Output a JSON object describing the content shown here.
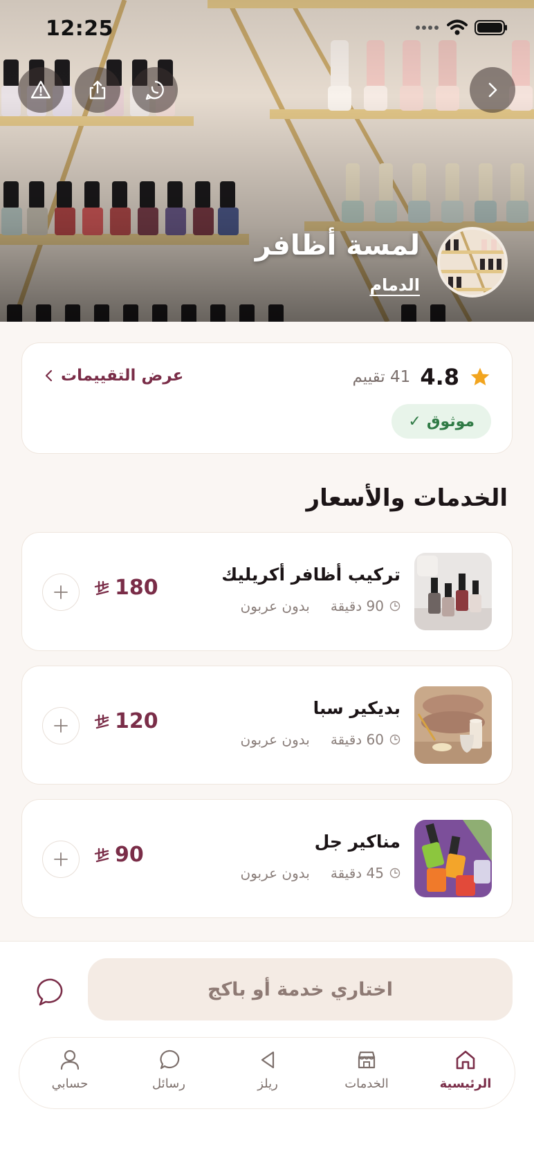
{
  "status_bar": {
    "time": "12:25"
  },
  "store": {
    "name": "لمسة أظافر",
    "city": "الدمام"
  },
  "rating": {
    "value": "4.8",
    "count_text": "41 تقييم",
    "view_reviews_label": "عرض التقييمات",
    "verified_label": "موثوق",
    "verified_check": "✓"
  },
  "services_section": {
    "title": "الخدمات والأسعار",
    "items": [
      {
        "name": "تركيب أظافر أكريليك",
        "duration": "90 دقيقة",
        "deposit": "بدون عربون",
        "price": "180"
      },
      {
        "name": "بديكير سبا",
        "duration": "60 دقيقة",
        "deposit": "بدون عربون",
        "price": "120"
      },
      {
        "name": "مناكير جل",
        "duration": "45 دقيقة",
        "deposit": "بدون عربون",
        "price": "90"
      }
    ]
  },
  "cta": {
    "label": "اختاري خدمة أو باكج"
  },
  "tabs": [
    {
      "label": "الرئيسية",
      "icon": "home-icon",
      "active": true
    },
    {
      "label": "الخدمات",
      "icon": "store-icon",
      "active": false
    },
    {
      "label": "ريلز",
      "icon": "play-icon",
      "active": false
    },
    {
      "label": "رسائل",
      "icon": "chat-icon",
      "active": false
    },
    {
      "label": "حسابي",
      "icon": "user-icon",
      "active": false
    }
  ],
  "colors": {
    "accent": "#7a2d48",
    "star": "#f2a51f",
    "verified_text": "#2f7a45",
    "verified_bg": "#e8f4ea",
    "cta_bg": "#f4ebe4",
    "page_bg": "#faf6f3"
  }
}
